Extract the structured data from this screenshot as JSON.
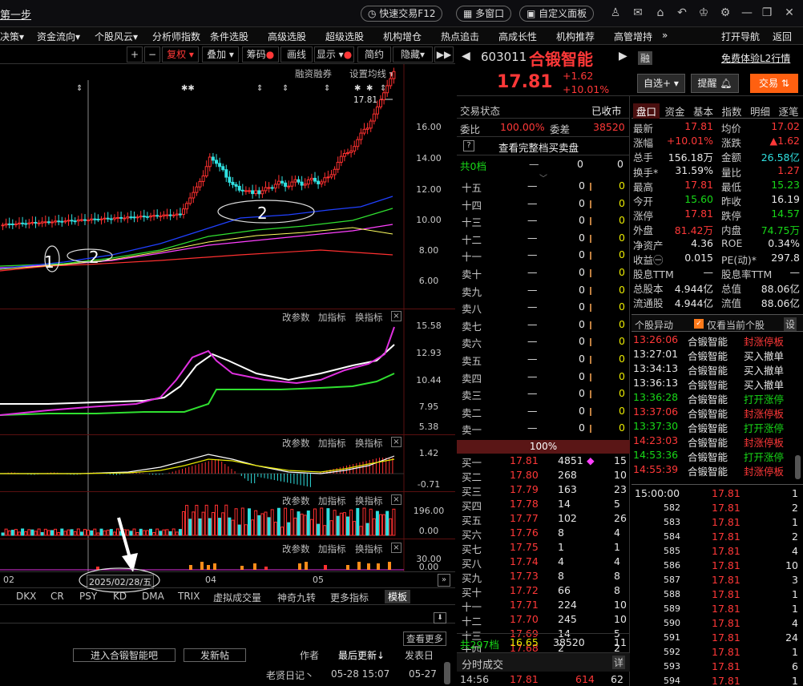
{
  "title_partial": "第一步",
  "topbar": {
    "fast_trade": "快速交易F12",
    "multi_window": "多窗口",
    "custom_panel": "自定义面板"
  },
  "menu": [
    {
      "label": "决策",
      "arrow": "▾"
    },
    {
      "label": "资金流向",
      "arrow": "▾"
    },
    {
      "label": "个股风云",
      "arrow": "▾"
    },
    {
      "label": "分析师指数"
    },
    {
      "label": "条件选股"
    },
    {
      "label": "高级选股"
    },
    {
      "label": "超级选股"
    },
    {
      "label": "机构增仓"
    },
    {
      "label": "热点追击"
    },
    {
      "label": "高成长性"
    },
    {
      "label": "机构推荐"
    },
    {
      "label": "高管增持"
    },
    {
      "label": "»"
    },
    {
      "label": "打开导航"
    },
    {
      "label": "返回"
    }
  ],
  "chart_toolbar": {
    "plus": "+",
    "minus": "−",
    "fuquan": "复权",
    "overlay": "叠加",
    "chouma": "筹码",
    "huaxian": "画线",
    "xianshi": "显示",
    "jianyue": "简约",
    "yincang": "隐藏"
  },
  "main_panel": {
    "rzrq": "融资融券",
    "ma_settings": "设置均线",
    "last_price_label": "17.81",
    "y_ticks": [
      "16.00",
      "14.00",
      "12.00",
      "10.00",
      "8.00",
      "6.00"
    ],
    "ann1": "1",
    "ann2": "2",
    "ann3": "2"
  },
  "ind_labels": {
    "change": "改参数",
    "add": "加指标",
    "switch": "换指标",
    "close": "×"
  },
  "ind1_ticks": [
    "15.58",
    "12.93",
    "10.44",
    "7.95",
    "5.38"
  ],
  "ind2_ticks": [
    "1.42",
    "-0.71"
  ],
  "ind3_ticks": [
    "196.00",
    "0.00"
  ],
  "ind4_ticks": [
    "30.00",
    "0.00"
  ],
  "x_axis": {
    "t1": "02",
    "t2": "04",
    "t3": "05",
    "cursor_date": "2025/02/28/五"
  },
  "bottom_tabs": [
    "DKX",
    "CR",
    "PSY",
    "KD",
    "DMA",
    "TRIX",
    "虚拟成交量",
    "神奇九转",
    "更多指标",
    "模板"
  ],
  "forum": {
    "check_more": "查看更多",
    "enter": "进入合锻智能吧",
    "post": "发新帖",
    "author": "作者",
    "last_update": "最后更新↓",
    "post_time": "发表日",
    "row_title": "老贤日记丶",
    "row_date1": "05-28 15:07",
    "row_date2": "05-27"
  },
  "stock": {
    "code": "603011",
    "name": "合锻智能",
    "price": "17.81",
    "change": "+1.62",
    "pct": "+10.01%",
    "rong": "融",
    "free_l2": "免费体验L2行情",
    "zixuan": "自选+",
    "tixing": "提醒",
    "jiaoyi": "交易"
  },
  "status": {
    "label": "交易状态",
    "value": "已收市",
    "weibi_label": "委比",
    "weibi": "100.00%",
    "weicha_label": "委差",
    "weicha": "38520",
    "full_book": "查看完整档买卖盘",
    "q": "?",
    "total0": "共0档",
    "total0_v1": "0",
    "total0_v2": "0"
  },
  "sell_rows": [
    {
      "l": "十五",
      "p": "—",
      "v": "0",
      "n": "0"
    },
    {
      "l": "十四",
      "p": "—",
      "v": "0",
      "n": "0"
    },
    {
      "l": "十三",
      "p": "—",
      "v": "0",
      "n": "0"
    },
    {
      "l": "十二",
      "p": "—",
      "v": "0",
      "n": "0"
    },
    {
      "l": "十一",
      "p": "—",
      "v": "0",
      "n": "0"
    },
    {
      "l": "卖十",
      "p": "—",
      "v": "0",
      "n": "0"
    },
    {
      "l": "卖九",
      "p": "—",
      "v": "0",
      "n": "0"
    },
    {
      "l": "卖八",
      "p": "—",
      "v": "0",
      "n": "0"
    },
    {
      "l": "卖七",
      "p": "—",
      "v": "0",
      "n": "0"
    },
    {
      "l": "卖六",
      "p": "—",
      "v": "0",
      "n": "0"
    },
    {
      "l": "卖五",
      "p": "—",
      "v": "0",
      "n": "0"
    },
    {
      "l": "卖四",
      "p": "—",
      "v": "0",
      "n": "0"
    },
    {
      "l": "卖三",
      "p": "—",
      "v": "0",
      "n": "0"
    },
    {
      "l": "卖二",
      "p": "—",
      "v": "0",
      "n": "0"
    },
    {
      "l": "卖一",
      "p": "—",
      "v": "0",
      "n": "0"
    }
  ],
  "ratio_bar": "100%",
  "buy_rows": [
    {
      "l": "买一",
      "p": "17.81",
      "v": "4851",
      "n": "15",
      "mark": "◆"
    },
    {
      "l": "买二",
      "p": "17.80",
      "v": "268",
      "n": "10"
    },
    {
      "l": "买三",
      "p": "17.79",
      "v": "163",
      "n": "23"
    },
    {
      "l": "买四",
      "p": "17.78",
      "v": "14",
      "n": "5"
    },
    {
      "l": "买五",
      "p": "17.77",
      "v": "102",
      "n": "26"
    },
    {
      "l": "买六",
      "p": "17.76",
      "v": "8",
      "n": "4"
    },
    {
      "l": "买七",
      "p": "17.75",
      "v": "1",
      "n": "1"
    },
    {
      "l": "买八",
      "p": "17.74",
      "v": "4",
      "n": "4"
    },
    {
      "l": "买九",
      "p": "17.73",
      "v": "8",
      "n": "8"
    },
    {
      "l": "买十",
      "p": "17.72",
      "v": "66",
      "n": "8"
    },
    {
      "l": "十一",
      "p": "17.71",
      "v": "224",
      "n": "10"
    },
    {
      "l": "十二",
      "p": "17.70",
      "v": "245",
      "n": "10"
    },
    {
      "l": "十三",
      "p": "17.69",
      "v": "14",
      "n": "5"
    },
    {
      "l": "十四",
      "p": "17.68",
      "v": "2",
      "n": "2"
    },
    {
      "l": "十五",
      "p": "17.65",
      "v": "10",
      "n": "10"
    }
  ],
  "buy_total": {
    "l": "共297档",
    "p": "16.65",
    "v": "38520",
    "n": "11"
  },
  "tick_hdr": {
    "label": "分时成交",
    "detail": "详"
  },
  "tick_row": {
    "t": "14:56",
    "p": "17.81",
    "v": "614",
    "n": "62"
  },
  "info_tabs": [
    "盘口",
    "资金",
    "基本",
    "指数",
    "明细",
    "逐笔"
  ],
  "info": [
    [
      {
        "l": "最新",
        "v": "17.81",
        "c": "r"
      },
      {
        "l": "均价",
        "v": "17.02",
        "c": "r"
      }
    ],
    [
      {
        "l": "涨幅",
        "v": "+10.01%",
        "c": "r"
      },
      {
        "l": "涨跌",
        "v": "▲1.62",
        "c": "r"
      }
    ],
    [
      {
        "l": "总手",
        "v": "156.18万",
        "c": "w"
      },
      {
        "l": "金额",
        "v": "26.58亿",
        "c": "c"
      }
    ],
    [
      {
        "l": "换手*",
        "v": "31.59%",
        "c": "w"
      },
      {
        "l": "量比",
        "v": "1.27",
        "c": "r"
      }
    ],
    [
      {
        "l": "最高",
        "v": "17.81",
        "c": "r"
      },
      {
        "l": "最低",
        "v": "15.23",
        "c": "g"
      }
    ],
    [
      {
        "l": "今开",
        "v": "15.60",
        "c": "g"
      },
      {
        "l": "昨收",
        "v": "16.19",
        "c": "w"
      }
    ],
    [
      {
        "l": "涨停",
        "v": "17.81",
        "c": "r"
      },
      {
        "l": "跌停",
        "v": "14.57",
        "c": "g"
      }
    ],
    [
      {
        "l": "外盘",
        "v": "81.42万",
        "c": "r"
      },
      {
        "l": "内盘",
        "v": "74.75万",
        "c": "g"
      }
    ],
    [
      {
        "l": "净资产",
        "v": "4.36",
        "c": "w"
      },
      {
        "l": "ROE",
        "v": "0.34%",
        "c": "w"
      }
    ],
    [
      {
        "l": "收益㊀",
        "v": "0.015",
        "c": "w"
      },
      {
        "l": "PE(动)*",
        "v": "297.8",
        "c": "w"
      }
    ],
    [
      {
        "l": "股息TTM",
        "v": "—",
        "c": "w"
      },
      {
        "l": "股息率TTM",
        "v": "—",
        "c": "w"
      }
    ],
    [
      {
        "l": "总股本",
        "v": "4.944亿",
        "c": "w"
      },
      {
        "l": "总值",
        "v": "88.06亿",
        "c": "w"
      }
    ],
    [
      {
        "l": "流通股",
        "v": "4.944亿",
        "c": "w"
      },
      {
        "l": "流值",
        "v": "88.06亿",
        "c": "w"
      }
    ]
  ],
  "events_hdr": {
    "label": "个股异动",
    "only_current": "仅看当前个股",
    "settings": "设"
  },
  "events": [
    {
      "t": "13:26:06",
      "n": "合锻智能",
      "e": "封涨停板",
      "c": "r"
    },
    {
      "t": "13:27:01",
      "n": "合锻智能",
      "e": "买入撤单",
      "c": "w"
    },
    {
      "t": "13:34:13",
      "n": "合锻智能",
      "e": "买入撤单",
      "c": "w"
    },
    {
      "t": "13:36:13",
      "n": "合锻智能",
      "e": "买入撤单",
      "c": "w"
    },
    {
      "t": "13:36:28",
      "n": "合锻智能",
      "e": "打开涨停",
      "c": "g"
    },
    {
      "t": "13:37:06",
      "n": "合锻智能",
      "e": "封涨停板",
      "c": "r"
    },
    {
      "t": "13:37:30",
      "n": "合锻智能",
      "e": "打开涨停",
      "c": "g"
    },
    {
      "t": "14:23:03",
      "n": "合锻智能",
      "e": "封涨停板",
      "c": "r"
    },
    {
      "t": "14:53:36",
      "n": "合锻智能",
      "e": "打开涨停",
      "c": "g"
    },
    {
      "t": "14:55:39",
      "n": "合锻智能",
      "e": "封涨停板",
      "c": "r"
    }
  ],
  "trades": [
    {
      "t": "15:00:00",
      "p": "17.81",
      "v": "1"
    },
    {
      "t": "582",
      "p": "17.81",
      "v": "2"
    },
    {
      "t": "583",
      "p": "17.81",
      "v": "1"
    },
    {
      "t": "584",
      "p": "17.81",
      "v": "2"
    },
    {
      "t": "585",
      "p": "17.81",
      "v": "4"
    },
    {
      "t": "586",
      "p": "17.81",
      "v": "10"
    },
    {
      "t": "587",
      "p": "17.81",
      "v": "3"
    },
    {
      "t": "588",
      "p": "17.81",
      "v": "1"
    },
    {
      "t": "589",
      "p": "17.81",
      "v": "1"
    },
    {
      "t": "590",
      "p": "17.81",
      "v": "4"
    },
    {
      "t": "591",
      "p": "17.81",
      "v": "24"
    },
    {
      "t": "592",
      "p": "17.81",
      "v": "1"
    },
    {
      "t": "593",
      "p": "17.81",
      "v": "6"
    },
    {
      "t": "594",
      "p": "17.81",
      "v": "1"
    }
  ]
}
